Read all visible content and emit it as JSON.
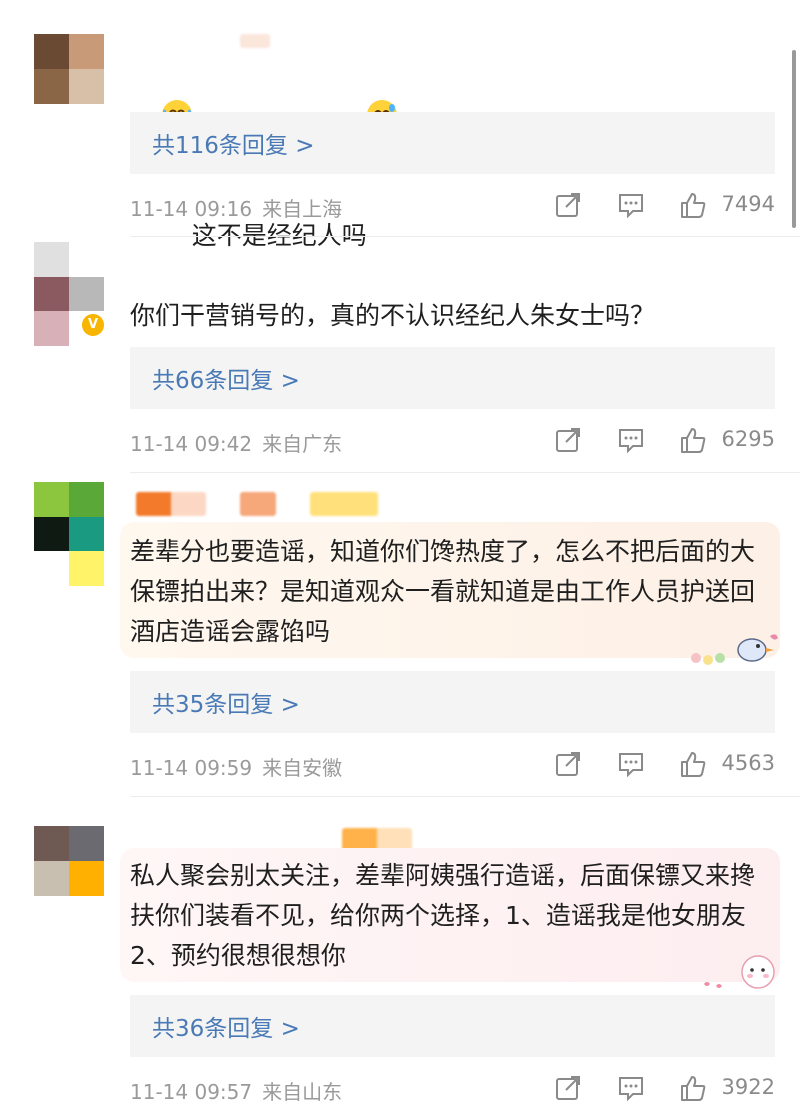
{
  "colors": {
    "reply_link": "#4a7ab6",
    "meta_text": "#9a9a9a",
    "reply_box": "#f4f4f4"
  },
  "icons": [
    "share-icon",
    "comment-icon",
    "like-icon",
    "verified-badge-icon",
    "laughing-crying-emoji",
    "grinning-sweat-emoji"
  ],
  "comments": [
    {
      "text": "这不是经纪人吗",
      "replies_label": "共116条回复 >",
      "time": "11-14 09:16",
      "location": "来自上海",
      "likes": "7494"
    },
    {
      "text": "你们干营销号的，真的不认识经纪人朱女士吗？",
      "replies_label": "共66条回复 >",
      "time": "11-14 09:42",
      "location": "来自广东",
      "likes": "6295",
      "verified_badge": "V"
    },
    {
      "text": "差辈分也要造谣，知道你们馋热度了，怎么不把后面的大保镖拍出来？是知道观众一看就知道是由工作人员护送回酒店造谣会露馅吗",
      "replies_label": "共35条回复 >",
      "time": "11-14 09:59",
      "location": "来自安徽",
      "likes": "4563"
    },
    {
      "text": "私人聚会别太关注，差辈阿姨强行造谣，后面保镖又来搀扶你们装看不见，给你两个选择，1、造谣我是他女朋友2、预约很想很想你",
      "replies_label": "共36条回复 >",
      "time": "11-14 09:57",
      "location": "来自山东",
      "likes": "3922"
    }
  ]
}
